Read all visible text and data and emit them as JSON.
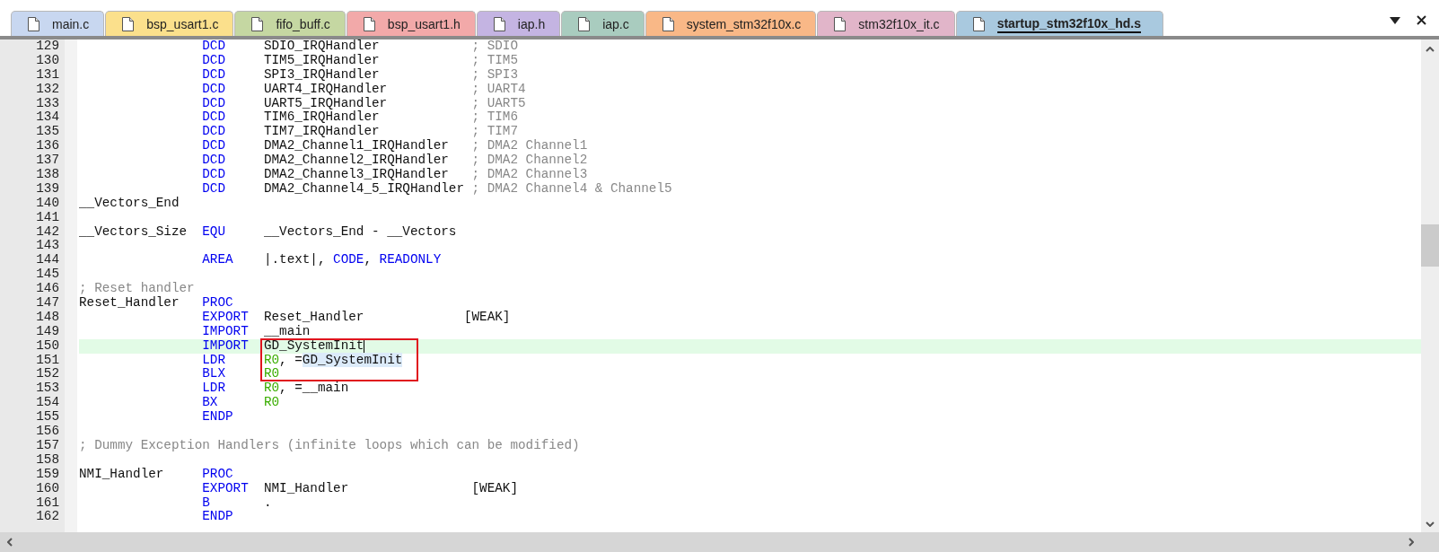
{
  "tabs": [
    {
      "label": "main.c",
      "color": "#c8d7f0",
      "selected": false
    },
    {
      "label": "bsp_usart1.c",
      "color": "#fbe08c",
      "selected": false
    },
    {
      "label": "fifo_buff.c",
      "color": "#c5d7a2",
      "selected": false
    },
    {
      "label": "bsp_usart1.h",
      "color": "#f2a9a9",
      "selected": false
    },
    {
      "label": "iap.h",
      "color": "#c4b4e2",
      "selected": false
    },
    {
      "label": "iap.c",
      "color": "#a9ccbf",
      "selected": false
    },
    {
      "label": "system_stm32f10x.c",
      "color": "#f9b887",
      "selected": false
    },
    {
      "label": "stm32f10x_it.c",
      "color": "#e1b5c9",
      "selected": false
    },
    {
      "label": "startup_stm32f10x_hd.s",
      "color": "#a9c9df",
      "selected": true
    }
  ],
  "lines": [
    {
      "number": "129",
      "op": "DCD",
      "operand": [
        {
          "kind": "plain",
          "text": "SDIO_IRQHandler"
        }
      ],
      "comment": "; SDIO"
    },
    {
      "number": "130",
      "op": "DCD",
      "operand": [
        {
          "kind": "plain",
          "text": "TIM5_IRQHandler"
        }
      ],
      "comment": "; TIM5"
    },
    {
      "number": "131",
      "op": "DCD",
      "operand": [
        {
          "kind": "plain",
          "text": "SPI3_IRQHandler"
        }
      ],
      "comment": "; SPI3"
    },
    {
      "number": "132",
      "op": "DCD",
      "operand": [
        {
          "kind": "plain",
          "text": "UART4_IRQHandler"
        }
      ],
      "comment": "; UART4"
    },
    {
      "number": "133",
      "op": "DCD",
      "operand": [
        {
          "kind": "plain",
          "text": "UART5_IRQHandler"
        }
      ],
      "comment": "; UART5"
    },
    {
      "number": "134",
      "op": "DCD",
      "operand": [
        {
          "kind": "plain",
          "text": "TIM6_IRQHandler"
        }
      ],
      "comment": "; TIM6"
    },
    {
      "number": "135",
      "op": "DCD",
      "operand": [
        {
          "kind": "plain",
          "text": "TIM7_IRQHandler"
        }
      ],
      "comment": "; TIM7"
    },
    {
      "number": "136",
      "op": "DCD",
      "operand": [
        {
          "kind": "plain",
          "text": "DMA2_Channel1_IRQHandler"
        }
      ],
      "comment": "; DMA2 Channel1"
    },
    {
      "number": "137",
      "op": "DCD",
      "operand": [
        {
          "kind": "plain",
          "text": "DMA2_Channel2_IRQHandler"
        }
      ],
      "comment": "; DMA2 Channel2"
    },
    {
      "number": "138",
      "op": "DCD",
      "operand": [
        {
          "kind": "plain",
          "text": "DMA2_Channel3_IRQHandler"
        }
      ],
      "comment": "; DMA2 Channel3"
    },
    {
      "number": "139",
      "op": "DCD",
      "operand": [
        {
          "kind": "plain",
          "text": "DMA2_Channel4_5_IRQHandler"
        }
      ],
      "comment": "; DMA2 Channel4 & Channel5"
    },
    {
      "number": "140",
      "label": "__Vectors_End"
    },
    {
      "number": "141"
    },
    {
      "number": "142",
      "label": "__Vectors_Size",
      "op": "EQU",
      "operand": [
        {
          "kind": "plain",
          "text": "__Vectors_End - __Vectors"
        }
      ]
    },
    {
      "number": "143"
    },
    {
      "number": "144",
      "op": "AREA",
      "operand": [
        {
          "kind": "plain",
          "text": "|.text|,"
        },
        {
          "kind": "keyword",
          "text": " CODE"
        },
        {
          "kind": "plain",
          "text": ","
        },
        {
          "kind": "keyword",
          "text": " READONLY"
        }
      ]
    },
    {
      "number": "145"
    },
    {
      "number": "146",
      "comment": "; Reset handler"
    },
    {
      "number": "147",
      "label": "Reset_Handler",
      "op": "PROC"
    },
    {
      "number": "148",
      "op": "EXPORT",
      "operand": [
        {
          "kind": "plain",
          "text": "Reset_Handler             [WEAK]"
        }
      ]
    },
    {
      "number": "149",
      "op": "IMPORT",
      "operand": [
        {
          "kind": "plain",
          "text": "__main"
        }
      ]
    },
    {
      "number": "150",
      "current": true,
      "cursor": true,
      "boxed": true,
      "op": "IMPORT",
      "operand": [
        {
          "kind": "plain",
          "text": "GD_SystemInit"
        }
      ]
    },
    {
      "number": "151",
      "boxed": true,
      "op": "LDR",
      "operand": [
        {
          "kind": "register",
          "text": "R0"
        },
        {
          "kind": "plain",
          "text": ", ="
        },
        {
          "kind": "match",
          "text": "GD_SystemInit"
        }
      ]
    },
    {
      "number": "152",
      "boxed": true,
      "op": "BLX",
      "operand": [
        {
          "kind": "register",
          "text": "R0"
        }
      ]
    },
    {
      "number": "153",
      "op": "LDR",
      "operand": [
        {
          "kind": "register",
          "text": "R0"
        },
        {
          "kind": "plain",
          "text": ", =__main"
        }
      ]
    },
    {
      "number": "154",
      "op": "BX",
      "operand": [
        {
          "kind": "register",
          "text": "R0"
        }
      ]
    },
    {
      "number": "155",
      "op": "ENDP"
    },
    {
      "number": "156"
    },
    {
      "number": "157",
      "comment": "; Dummy Exception Handlers (infinite loops which can be modified)"
    },
    {
      "number": "158"
    },
    {
      "number": "159",
      "label": "NMI_Handler",
      "op": "PROC"
    },
    {
      "number": "160",
      "op": "EXPORT",
      "operand": [
        {
          "kind": "plain",
          "text": "NMI_Handler                [WEAK]"
        }
      ]
    },
    {
      "number": "161",
      "op": "B",
      "operand": [
        {
          "kind": "plain",
          "text": "."
        }
      ]
    },
    {
      "number": "162",
      "op": "ENDP"
    }
  ]
}
